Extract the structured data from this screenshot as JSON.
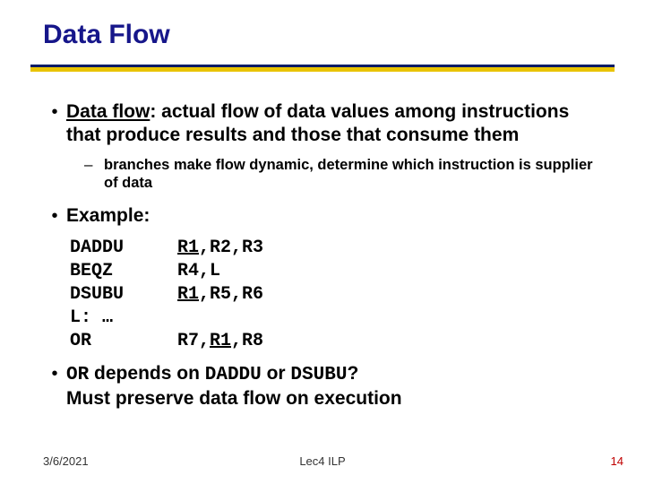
{
  "title": "Data Flow",
  "bullets": {
    "b1_term": "Data flow",
    "b1_rest": ": actual flow of data values among instructions that produce results and those that consume them",
    "b2": "branches make flow dynamic, determine which instruction is supplier of data",
    "b3": "Example:",
    "b4_pre": " depends on ",
    "b4_or": "OR",
    "b4_daddu": "DADDU",
    "b4_mid": " or ",
    "b4_dsubu": "DSUBU",
    "b4_q": "?",
    "b4_line2": "Must preserve data flow on execution"
  },
  "code": {
    "rows": [
      {
        "op": "DADDU",
        "args_pre": "",
        "args_u": "R1",
        "args_post": ",R2,R3"
      },
      {
        "op": "BEQZ",
        "args_pre": "R4,L",
        "args_u": "",
        "args_post": ""
      },
      {
        "op": "DSUBU",
        "args_pre": "",
        "args_u": "R1",
        "args_post": ",R5,R6"
      },
      {
        "op": "L: …",
        "args_pre": "",
        "args_u": "",
        "args_post": ""
      },
      {
        "op": "OR",
        "args_pre": "R7,",
        "args_u": "R1",
        "args_post": ",R8"
      }
    ]
  },
  "footer": {
    "date": "3/6/2021",
    "mid": "Lec4 ILP",
    "num": "14"
  }
}
